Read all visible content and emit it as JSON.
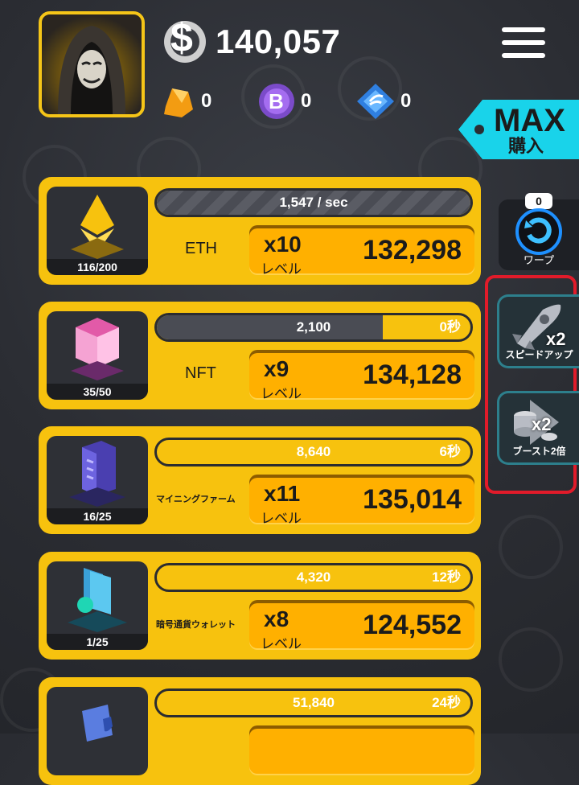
{
  "header": {
    "balance": "140,057",
    "resources": [
      {
        "icon": "ore-gem-icon",
        "value": "0"
      },
      {
        "icon": "bitcoin-coin-icon",
        "value": "0"
      },
      {
        "icon": "blue-token-icon",
        "value": "0"
      }
    ],
    "max_tag": {
      "title": "MAX",
      "subtitle": "購入"
    }
  },
  "side": {
    "warp": {
      "badge": "0",
      "label": "ワープ"
    },
    "speed_up": {
      "badge": "x2",
      "label": "スピードアップ"
    },
    "boost": {
      "badge": "x2",
      "label": "ブースト2倍"
    }
  },
  "cards": [
    {
      "name": "ETH",
      "count": "116/200",
      "progress_fraction": 0.58,
      "bar_text": "1,547  / sec",
      "bar_right": "",
      "bar_fill": 1.0,
      "multiplier": "x10",
      "level_label": "レベル",
      "cost": "132,298"
    },
    {
      "name": "NFT",
      "count": "35/50",
      "progress_fraction": 0.7,
      "bar_text": "2,100",
      "bar_right": "0秒",
      "bar_fill": 0.72,
      "multiplier": "x9",
      "level_label": "レベル",
      "cost": "134,128"
    },
    {
      "name": "マイニングファーム",
      "count": "16/25",
      "progress_fraction": 0.64,
      "bar_text": "8,640",
      "bar_right": "6秒",
      "bar_fill": 0.0,
      "multiplier": "x11",
      "level_label": "レベル",
      "cost": "135,014"
    },
    {
      "name": "暗号通貨ウォレット",
      "count": "1/25",
      "progress_fraction": 0.04,
      "bar_text": "4,320",
      "bar_right": "12秒",
      "bar_fill": 0.0,
      "multiplier": "x8",
      "level_label": "レベル",
      "cost": "124,552"
    },
    {
      "name": "",
      "count": "",
      "progress_fraction": 0.0,
      "bar_text": "51,840",
      "bar_right": "24秒",
      "bar_fill": 0.0,
      "multiplier": "",
      "level_label": "",
      "cost": ""
    }
  ]
}
